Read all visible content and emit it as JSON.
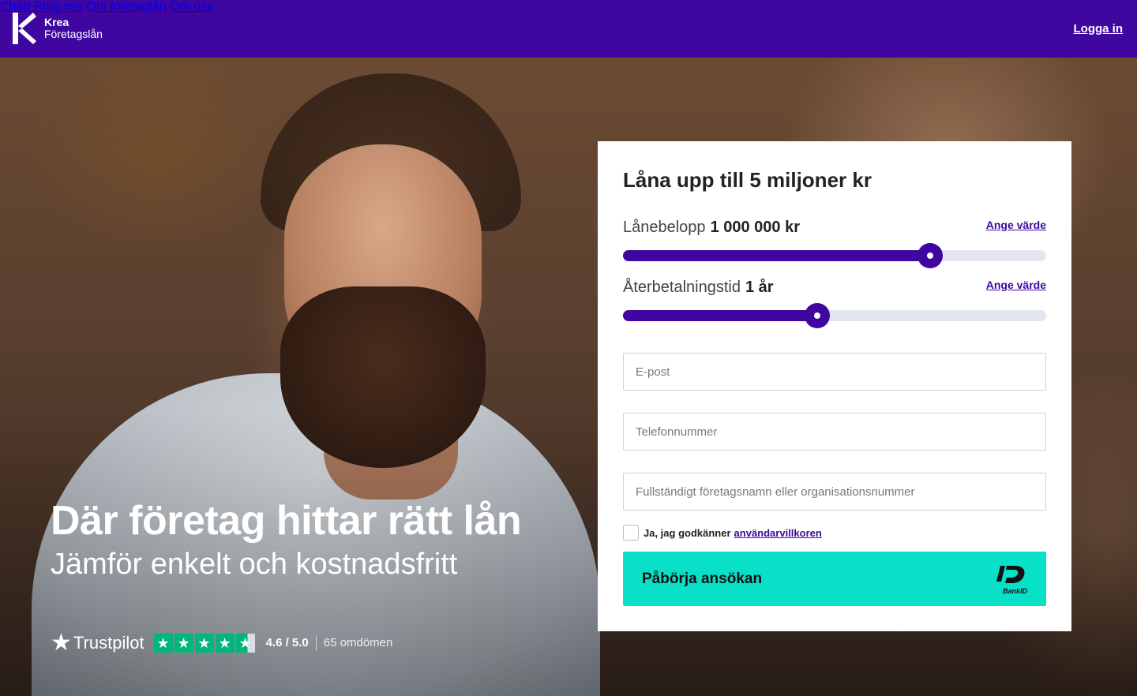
{
  "header": {
    "brand_line1": "Krea",
    "brand_line2": "Företagslån",
    "nav": [
      "Chatt",
      "Ring oss",
      "Om företaglån",
      "Om oss"
    ],
    "login_label": "Logga in",
    "bg_color": "#3f06a0"
  },
  "hero": {
    "headline": "Där företag hittar rätt lån",
    "subheadline": "Jämför enkelt och kostnadsfritt",
    "trustpilot": {
      "brand": "Trustpilot",
      "rating": 4.6,
      "rating_label": "4.6 / 5.0",
      "reviews_label": "65 omdömen",
      "star_color": "#00b67a"
    }
  },
  "form": {
    "title": "Låna upp till 5 miljoner kr",
    "amount": {
      "label": "Lånebelopp",
      "value_text": "1 000 000 kr",
      "set_value_link": "Ange värde",
      "fill_fraction": 0.725
    },
    "term": {
      "label": "Återbetalningstid",
      "value_text": "1 år",
      "set_value_link": "Ange värde",
      "fill_fraction": 0.459
    },
    "fields": {
      "email_placeholder": "E-post",
      "phone_placeholder": "Telefonnummer",
      "company_placeholder": "Fullständigt företagsnamn eller organisationsnummer"
    },
    "consent": {
      "prefix": "Ja, jag godkänner",
      "link": "användarvillkoren"
    },
    "cta": {
      "label": "Påbörja ansökan",
      "bankid_label": "BankID",
      "color": "#08e0c8"
    },
    "accent_color": "#3f06a0"
  }
}
